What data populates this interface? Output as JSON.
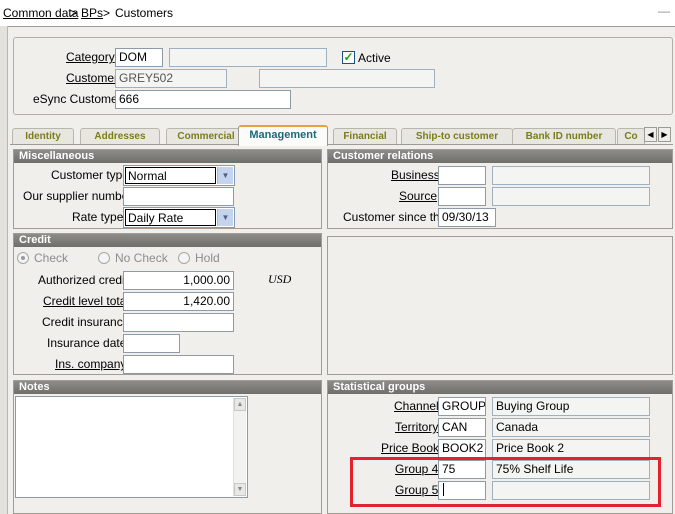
{
  "breadcrumb": {
    "item1": "Common data",
    "sep1": ">",
    "item2": "BPs",
    "sep2": ">",
    "item3": "Customers"
  },
  "window_controls": {
    "minimize_icon": "minus-icon"
  },
  "header": {
    "category_label": "Category",
    "category_value": "DOM",
    "category_desc": "",
    "active_label": "Active",
    "active_checked": true,
    "customer_label": "Customer",
    "customer_value": "GREY502",
    "customer_desc": "",
    "esync_label": "eSync Customer",
    "esync_value": "666"
  },
  "tabs": [
    "Identity",
    "Addresses",
    "Commercial",
    "Management",
    "Financial",
    "Ship-to customer",
    "Bank ID number",
    "Co"
  ],
  "active_tab": "Management",
  "misc": {
    "title": "Miscellaneous",
    "customer_type_label": "Customer type",
    "customer_type_value": "Normal",
    "supplier_number_label": "Our supplier number",
    "supplier_number_value": "",
    "rate_type_label": "Rate type",
    "rate_type_value": "Daily Rate"
  },
  "relations": {
    "title": "Customer relations",
    "business_label": "Business",
    "business_value": "",
    "business_desc": "",
    "source_label": "Source",
    "source_value": "",
    "source_desc": "",
    "since_label": "Customer since the",
    "since_value": "09/30/13"
  },
  "credit": {
    "title": "Credit",
    "radio_check": "Check",
    "radio_no_check": "No Check",
    "radio_hold": "Hold",
    "selected": "Check",
    "authorized_label": "Authorized credit",
    "authorized_value": "1,000.00",
    "currency": "USD",
    "level_label": "Credit level total",
    "level_value": "1,420.00",
    "insurance_label": "Credit insurance",
    "insurance_value": "",
    "insurance_date_label": "Insurance date",
    "insurance_date_value": "",
    "ins_company_label": "Ins. company",
    "ins_company_value": ""
  },
  "notes": {
    "title": "Notes",
    "value": ""
  },
  "stat": {
    "title": "Statistical groups",
    "rows": [
      {
        "label": "Channel",
        "code": "GROUP",
        "desc": "Buying Group"
      },
      {
        "label": "Territory",
        "code": "CAN",
        "desc": "Canada"
      },
      {
        "label": "Price Book",
        "code": "BOOK2",
        "desc": "Price Book 2"
      },
      {
        "label": "Group 4",
        "code": "75",
        "desc": "75% Shelf Life"
      },
      {
        "label": "Group 5",
        "code": "",
        "desc": ""
      }
    ]
  },
  "colors": {
    "highlight": "#e2232e",
    "active_tab_text": "#1a6b7a",
    "tab_text": "#7a7d18",
    "group_header": "#7d7c78"
  }
}
